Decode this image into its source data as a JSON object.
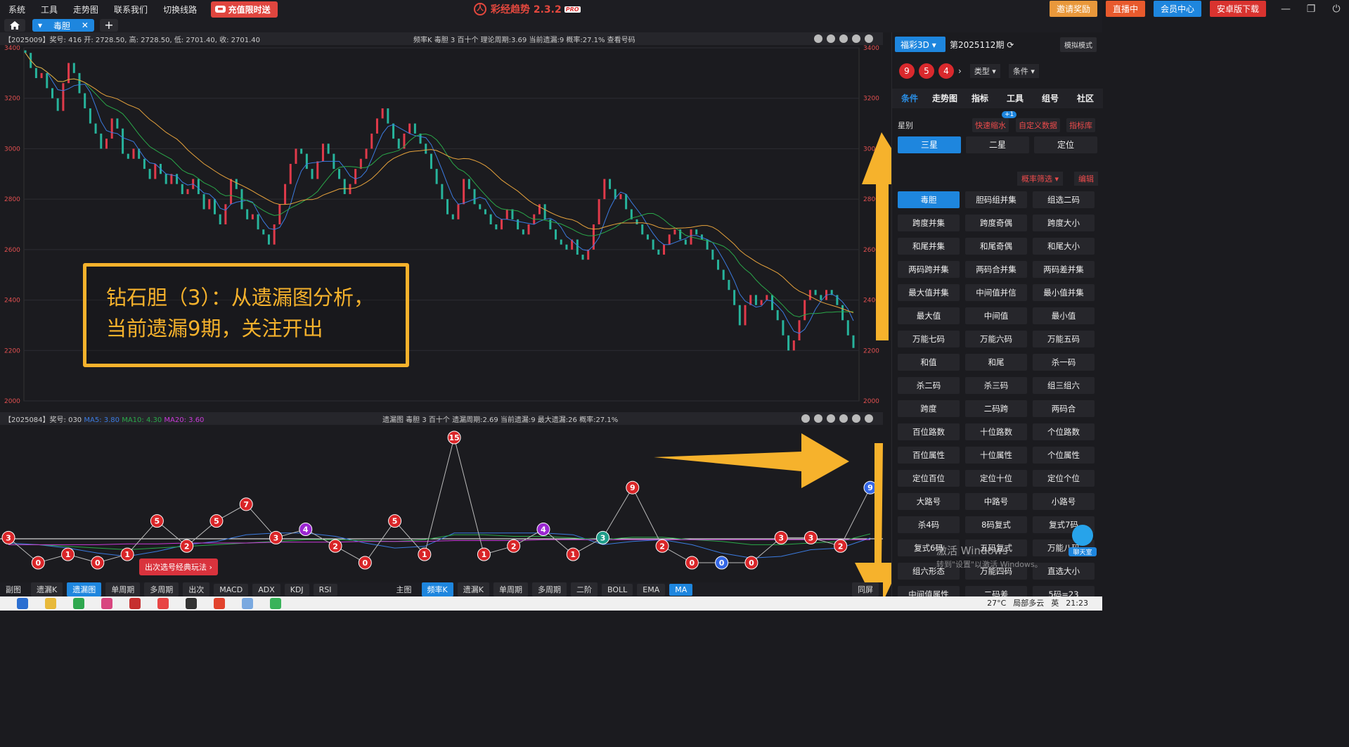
{
  "menu": {
    "items": [
      "系统",
      "工具",
      "走势图",
      "联系我们",
      "切换线路"
    ],
    "promo": "充值限时送"
  },
  "app": {
    "title": "彩经趋势 2.3.2",
    "pro": "PRO"
  },
  "topbar": {
    "invite": "邀请奖励",
    "live": "直播中",
    "vip": "会员中心",
    "android": "安卓版下载"
  },
  "tabs": {
    "active": "毒胆"
  },
  "main_info": {
    "left": "【2025009】奖号: 416  开: 2728.50, 高: 2728.50, 低: 2701.40, 收: 2701.40",
    "mid": "频率K   毒胆   3   百十个   理论周期:3.69   当前遗漏:9   概率:27.1%      查看号码"
  },
  "lower_info": {
    "prefix": "【2025084】奖号: 030 ",
    "ma5": "MA5: 3.80",
    "ma10": "MA10: 4.30",
    "ma20": "MA20: 3.60",
    "mid": "遗漏图   毒胆   3   百十个   遗漏周期:2.69   当前遗漏:9   最大遗漏:26   概率:27.1%"
  },
  "annotation": {
    "line1": "钻石胆（3）：从遗漏图分析，",
    "line2": "当前遗漏9期，关注开出"
  },
  "hint": "出次选号经典玩法 ›",
  "bottom_left": [
    "副图",
    "遗漏K",
    "遗漏图",
    "单周期",
    "多周期",
    "出次",
    "MACD",
    "ADX",
    "KDJ",
    "RSI"
  ],
  "bottom_right": [
    "主图",
    "频率K",
    "遗漏K",
    "单周期",
    "多周期",
    "二阶",
    "BOLL",
    "EMA",
    "MA"
  ],
  "bottom_end": "同屏",
  "sidebar": {
    "lottery": "福彩3D",
    "period": "第2025112期",
    "sim": "模拟模式",
    "balls": [
      "9",
      "5",
      "4"
    ],
    "dd_type": "类型",
    "dd_cond": "条件",
    "nav": [
      "条件",
      "走势图",
      "指标",
      "工具",
      "组号",
      "社区"
    ],
    "star_label": "星别",
    "quick": "快速缩水",
    "badge": "+1",
    "custom": "自定义数据",
    "lib": "指标库",
    "star_btns": [
      "三星",
      "二星",
      "定位"
    ],
    "filter": "概率筛选",
    "edit": "编辑",
    "grid": [
      "毒胆",
      "胆码组并集",
      "组选二码",
      "跨度并集",
      "跨度奇偶",
      "跨度大小",
      "和尾并集",
      "和尾奇偶",
      "和尾大小",
      "两码跨并集",
      "两码合并集",
      "两码差并集",
      "最大值并集",
      "中间值并信",
      "最小值并集",
      "最大值",
      "中间值",
      "最小值",
      "万能七码",
      "万能六码",
      "万能五码",
      "和值",
      "和尾",
      "杀一码",
      "杀二码",
      "杀三码",
      "组三组六",
      "跨度",
      "二码跨",
      "两码合",
      "百位路数",
      "十位路数",
      "个位路数",
      "百位属性",
      "十位属性",
      "个位属性",
      "定位百位",
      "定位十位",
      "定位个位",
      "大路号",
      "中路号",
      "小路号",
      "杀4码",
      "8码复式",
      "复式7码",
      "复式6码",
      "五码复式",
      "万能八码",
      "组六形态",
      "万能四码",
      "直选大小",
      "中间值属性",
      "二码差",
      "5码=23"
    ],
    "chat": "聊天室"
  },
  "watermark": {
    "l1": "激活 Windows",
    "l2": "转到\"设置\"以激活 Windows。"
  },
  "tray": {
    "temp": "27°C",
    "weather": "局部多云",
    "lang": "英",
    "time": "21:23"
  },
  "chart_data": [
    {
      "type": "candlestick",
      "title": "",
      "ylim": [
        2000,
        3400
      ],
      "yticks": [
        2000,
        2200,
        2400,
        2600,
        2800,
        3000,
        3200,
        3400
      ],
      "close_series": [
        3380,
        3320,
        3280,
        3300,
        3240,
        3200,
        3150,
        3260,
        3340,
        3300,
        3220,
        3160,
        3100,
        3060,
        3000,
        3040,
        3120,
        3080,
        2980,
        2960,
        3000,
        2960,
        2920,
        2880,
        2940,
        2900,
        2860,
        2900,
        2860,
        2820,
        2840,
        2880,
        2820,
        2760,
        2800,
        2740,
        2700,
        2780,
        2880,
        2840,
        2760,
        2720,
        2740,
        2680,
        2660,
        2620,
        2700,
        2780,
        2860,
        2940,
        3000,
        2980,
        2920,
        2880,
        2950,
        3020,
        2980,
        2920,
        2880,
        2820,
        2860,
        2920,
        2960,
        3000,
        3060,
        3120,
        3160,
        3100,
        3040,
        3000,
        3060,
        3100,
        3060,
        3020,
        2980,
        2920,
        2860,
        2800,
        2740,
        2720,
        2780,
        2880,
        2840,
        2780,
        2760,
        2740,
        2700,
        2680,
        2720,
        2760,
        2720,
        2680,
        2660,
        2700,
        2740,
        2780,
        2720,
        2680,
        2640,
        2620,
        2600,
        2640,
        2580,
        2560,
        2600,
        2700,
        2800,
        2880,
        2840,
        2800,
        2820,
        2760,
        2720,
        2700,
        2660,
        2640,
        2600,
        2580,
        2620,
        2660,
        2680,
        2640,
        2620,
        2680,
        2660,
        2640,
        2600,
        2560,
        2520,
        2480,
        2440,
        2380,
        2300,
        2380,
        2420,
        2380,
        2400,
        2420,
        2360,
        2320,
        2260,
        2200,
        2240,
        2320,
        2400,
        2440,
        2420,
        2400,
        2440,
        2420,
        2380,
        2320,
        2260,
        2210
      ],
      "series": [
        {
          "name": "",
          "color": "#3b7be0"
        },
        {
          "name": "",
          "color": "#2aa84a"
        },
        {
          "name": "",
          "color": "#e6a23c"
        }
      ]
    },
    {
      "type": "line",
      "title": "",
      "points": [
        3,
        0,
        1,
        0,
        1,
        5,
        2,
        5,
        7,
        3,
        4,
        2,
        0,
        5,
        1,
        15,
        1,
        2,
        4,
        1,
        3,
        9,
        2,
        0,
        0,
        0,
        3,
        3,
        2,
        9
      ],
      "point_labels": [
        "3",
        "0",
        "1",
        "0",
        "1",
        "5",
        "2",
        "5",
        "7",
        "3",
        "4",
        "2",
        "0",
        "5",
        "1",
        "15",
        "1",
        "2",
        "4",
        "1",
        "3",
        "9",
        "2",
        "0",
        "0",
        "0",
        "3",
        "3",
        "2",
        "9"
      ],
      "highlight": {
        "4": "#9b27d1",
        "3": "#1f9d8a",
        "9_last": "#3467e6"
      },
      "series": [
        {
          "name": "MA5",
          "color": "#3b7be0",
          "values": [
            3.2,
            3.0,
            2.6,
            2.0,
            1.6,
            2.2,
            3.0,
            3.4,
            4.2,
            4.4,
            4.4,
            4.0,
            3.2,
            2.6,
            2.8,
            4.4,
            4.4,
            4.4,
            4.4,
            4.2,
            3.0,
            3.4,
            3.6,
            3.0,
            2.0,
            1.4,
            1.6,
            2.4,
            2.6,
            3.8
          ]
        },
        {
          "name": "MA10",
          "color": "#2aa84a",
          "values": [
            3.0,
            3.0,
            2.8,
            2.6,
            2.4,
            2.6,
            2.8,
            3.0,
            3.2,
            3.4,
            3.6,
            3.6,
            3.5,
            3.4,
            3.6,
            4.2,
            4.2,
            4.0,
            4.0,
            3.8,
            3.6,
            3.9,
            3.9,
            3.6,
            3.4,
            3.0,
            3.0,
            3.2,
            3.4,
            4.3
          ]
        },
        {
          "name": "MA20",
          "color": "#c93ad9",
          "values": [
            3.0,
            3.0,
            3.0,
            3.0,
            3.1,
            3.1,
            3.2,
            3.2,
            3.2,
            3.3,
            3.3,
            3.3,
            3.4,
            3.4,
            3.4,
            3.5,
            3.5,
            3.5,
            3.6,
            3.6,
            3.6,
            3.6,
            3.6,
            3.6,
            3.6,
            3.6,
            3.6,
            3.6,
            3.6,
            3.6
          ]
        }
      ]
    }
  ]
}
